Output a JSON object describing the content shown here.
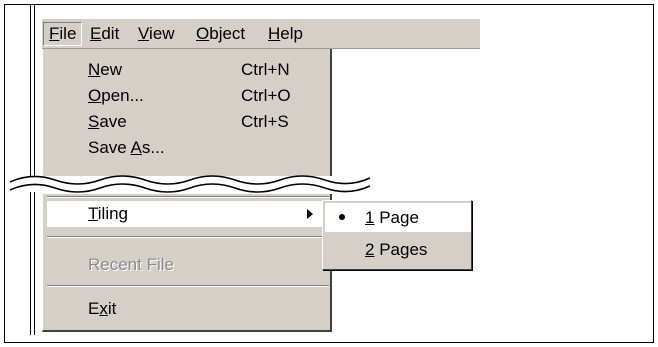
{
  "menubar": {
    "items": [
      {
        "pre": "",
        "key": "F",
        "post": "ile"
      },
      {
        "pre": "",
        "key": "E",
        "post": "dit"
      },
      {
        "pre": "",
        "key": "V",
        "post": "iew"
      },
      {
        "pre": "",
        "key": "O",
        "post": "bject"
      },
      {
        "pre": "",
        "key": "H",
        "post": "elp"
      }
    ]
  },
  "file_menu": {
    "top_items": [
      {
        "pre": "",
        "key": "N",
        "post": "ew",
        "shortcut": "Ctrl+N"
      },
      {
        "pre": "",
        "key": "O",
        "post": "pen...",
        "shortcut": "Ctrl+O"
      },
      {
        "pre": "",
        "key": "S",
        "post": "ave",
        "shortcut": "Ctrl+S"
      },
      {
        "pre": "Save ",
        "key": "A",
        "post": "s...",
        "shortcut": ""
      }
    ],
    "tiling": {
      "pre": "",
      "key": "T",
      "post": "iling"
    },
    "recent": {
      "label": "Recent File"
    },
    "exit": {
      "pre": "E",
      "key": "x",
      "post": "it"
    }
  },
  "tiling_submenu": {
    "items": [
      {
        "pre": "",
        "key": "1",
        "post": " Page",
        "checked": true
      },
      {
        "pre": "",
        "key": "2",
        "post": " Pages",
        "checked": false
      }
    ]
  }
}
